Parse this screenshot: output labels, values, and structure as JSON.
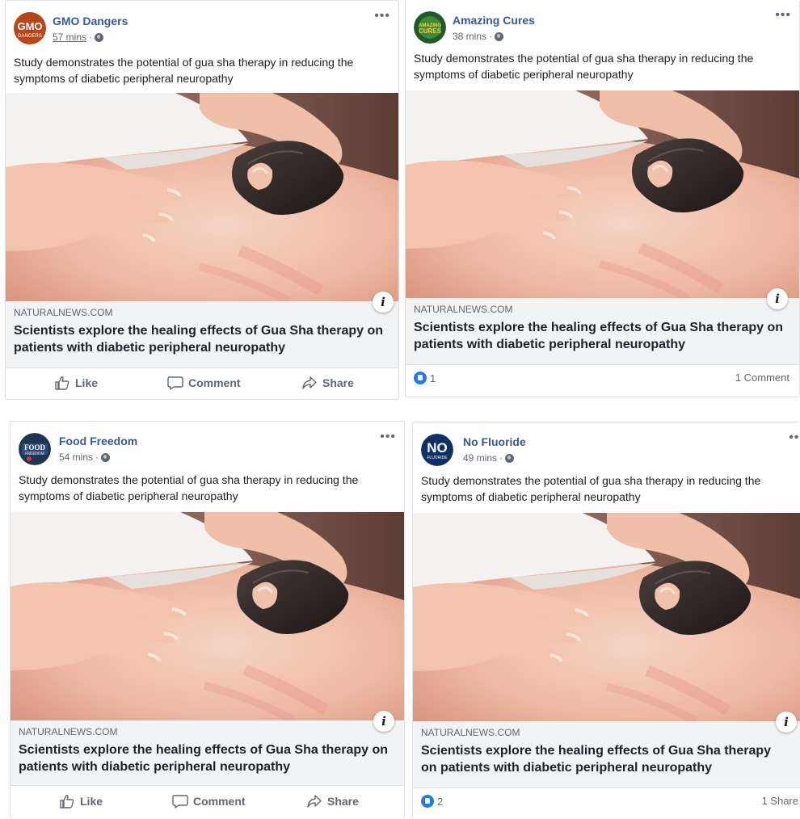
{
  "posts": [
    {
      "page": "GMO Dangers",
      "time": "57 mins",
      "time_sep": "·",
      "avatar_text": [
        "GMO",
        "DANGERS"
      ],
      "caption": "Study demonstrates the potential of gua sha therapy in reducing the symptoms of diabetic peripheral neuropathy",
      "domain": "NATURALNEWS.COM",
      "headline": "Scientists explore the healing effects of Gua Sha therapy on patients with diabetic peripheral neuropathy",
      "actions": {
        "like": "Like",
        "comment": "Comment",
        "share": "Share"
      }
    },
    {
      "page": "Amazing Cures",
      "time": "38 mins",
      "time_sep": "·",
      "avatar_text": [
        "AMAZING",
        "CURES"
      ],
      "caption": "Study demonstrates the potential of gua sha therapy in reducing the symptoms of diabetic peripheral neuropathy",
      "domain": "NATURALNEWS.COM",
      "headline": "Scientists explore the healing effects of Gua Sha therapy on patients with diabetic peripheral neuropathy",
      "reaction_count": "1",
      "right_count": "1 Comment"
    },
    {
      "page": "Food Freedom",
      "time": "54 mins",
      "time_sep": "·",
      "avatar_text": [
        "FOOD",
        "FREEDOM"
      ],
      "caption": "Study demonstrates the potential of gua sha therapy in reducing the symptoms of diabetic peripheral neuropathy",
      "domain": "NATURALNEWS.COM",
      "headline": "Scientists explore the healing effects of Gua Sha therapy on patients with diabetic peripheral neuropathy",
      "actions": {
        "like": "Like",
        "comment": "Comment",
        "share": "Share"
      }
    },
    {
      "page": "No Fluoride",
      "time": "49 mins",
      "time_sep": "·",
      "avatar_text": [
        "NO",
        "FLUORIDE"
      ],
      "caption": "Study demonstrates the potential of gua sha therapy in reducing the symptoms of diabetic peripheral neuropathy",
      "domain": "NATURALNEWS.COM",
      "headline": "Scientists explore the healing effects of Gua Sha therapy on patients with diabetic peripheral neuropathy",
      "reaction_count": "2",
      "right_count": "1 Share"
    }
  ],
  "more_glyph": "•••",
  "info_glyph": "i",
  "colors": {
    "link_blue": "#385898",
    "like_blue": "#2078f4",
    "text_gray": "#606770"
  },
  "icons": {
    "like": "thumbs-up-icon",
    "comment": "comment-bubble-icon",
    "share": "share-arrow-icon",
    "privacy": "globe-icon",
    "more": "more-options-icon",
    "info": "info-icon"
  }
}
